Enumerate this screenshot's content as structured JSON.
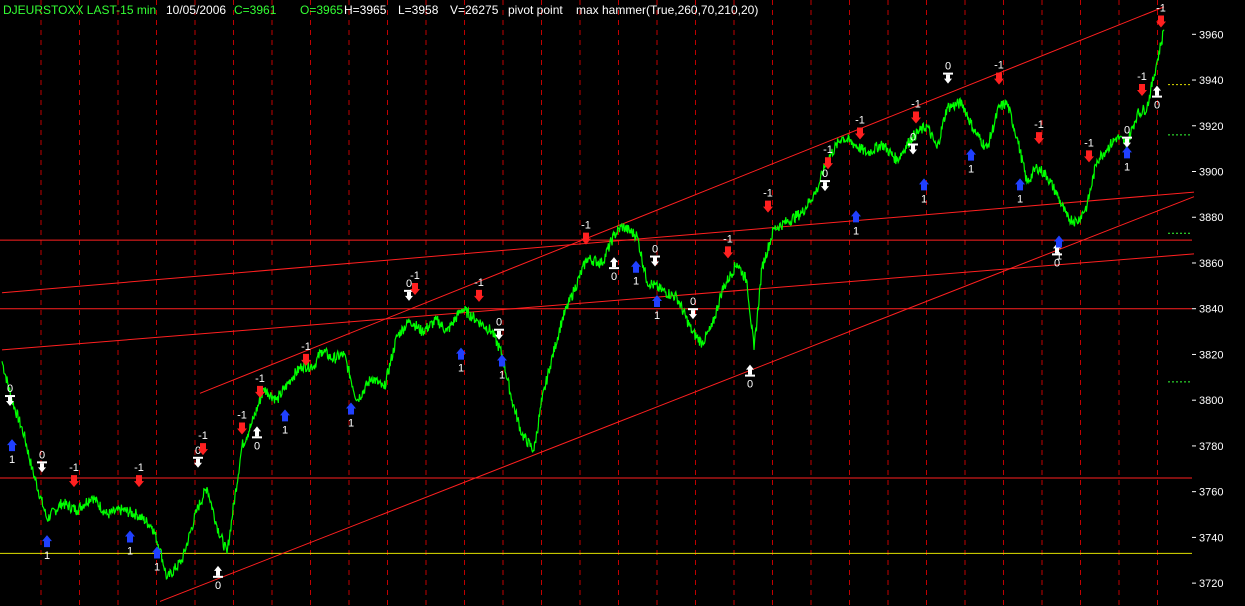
{
  "header": {
    "symbol": "DJEURSTOXX LAST-15 min",
    "date": "10/05/2006",
    "close": "C=3961",
    "open": "O=3965",
    "high": "H=3965",
    "low": "L=3958",
    "volume": "V=26275",
    "indicator1": "pivot point",
    "indicator2": "max hammer(True,260,70,210,20)"
  },
  "colors": {
    "background": "#000000",
    "price": "#00ff00",
    "grid": "#c00000",
    "trendline": "#ff2020",
    "level_yellow": "#e0e000",
    "down_arrow": "#ff2020",
    "up_arrow_blue": "#2040ff",
    "up_arrow_white": "#ffffff",
    "tick_text": "#ffffff"
  },
  "chart_data": {
    "type": "line",
    "title": "",
    "xlabel": "",
    "ylabel": "",
    "ylim": [
      3710,
      3975
    ],
    "y_ticks": [
      3720,
      3740,
      3760,
      3780,
      3800,
      3820,
      3840,
      3860,
      3880,
      3900,
      3920,
      3940,
      3960
    ],
    "grid": "dashed vertical lines only",
    "x_domain": [
      0,
      1165
    ],
    "series": [
      {
        "x": [
          0,
          10,
          22,
          30,
          45,
          60,
          75,
          90,
          105,
          120,
          135,
          150,
          158,
          165,
          180,
          195,
          205,
          215,
          225,
          240,
          250,
          262,
          275,
          290,
          300,
          312,
          320,
          330,
          342,
          355,
          370,
          382,
          395,
          408,
          420,
          435,
          445,
          460,
          475,
          490,
          500,
          510,
          520,
          532,
          540,
          548,
          560,
          572,
          585,
          600,
          612,
          620,
          635,
          645,
          660,
          675,
          690,
          700,
          710,
          720,
          735,
          745,
          752,
          760,
          772,
          785,
          800,
          815,
          825,
          840,
          852,
          865,
          880,
          895,
          910,
          925,
          935,
          945,
          960,
          972,
          985,
          997,
          1005,
          1015,
          1025,
          1035,
          1045,
          1055,
          1065,
          1075,
          1085,
          1095,
          1105,
          1115,
          1125,
          1135,
          1145,
          1155,
          1162
        ],
        "values": [
          3817,
          3800,
          3785,
          3770,
          3748,
          3755,
          3752,
          3758,
          3750,
          3752,
          3750,
          3745,
          3735,
          3722,
          3730,
          3752,
          3762,
          3745,
          3733,
          3780,
          3790,
          3805,
          3800,
          3810,
          3815,
          3815,
          3822,
          3818,
          3820,
          3800,
          3810,
          3805,
          3828,
          3835,
          3830,
          3835,
          3830,
          3840,
          3835,
          3830,
          3820,
          3800,
          3785,
          3778,
          3800,
          3815,
          3835,
          3848,
          3862,
          3860,
          3872,
          3876,
          3872,
          3852,
          3848,
          3845,
          3830,
          3825,
          3832,
          3848,
          3860,
          3852,
          3822,
          3858,
          3875,
          3878,
          3882,
          3892,
          3905,
          3915,
          3912,
          3908,
          3912,
          3905,
          3915,
          3920,
          3910,
          3928,
          3930,
          3918,
          3910,
          3928,
          3930,
          3915,
          3895,
          3902,
          3898,
          3890,
          3880,
          3878,
          3885,
          3905,
          3910,
          3915,
          3912,
          3925,
          3928,
          3948,
          3962
        ]
      }
    ],
    "horizontal_levels": [
      {
        "value": 3870,
        "color": "#ff2020"
      },
      {
        "value": 3840,
        "color": "#ff2020"
      },
      {
        "value": 3766,
        "color": "#ff2020"
      },
      {
        "value": 3733,
        "color": "#e0e000"
      }
    ],
    "trendlines": [
      {
        "x1": 198,
        "y1": 3803,
        "x2": 1162,
        "y2": 3972
      },
      {
        "x1": 0,
        "y1": 3847,
        "x2": 1192,
        "y2": 3891
      },
      {
        "x1": 0,
        "y1": 3822,
        "x2": 1192,
        "y2": 3864
      },
      {
        "x1": 158,
        "y1": 3712,
        "x2": 1192,
        "y2": 3889
      }
    ],
    "right_dashes": [
      {
        "value": 3938,
        "color": "#e0e000"
      },
      {
        "value": 3916,
        "color": "#34ff34"
      },
      {
        "value": 3873,
        "color": "#34ff34"
      },
      {
        "value": 3808,
        "color": "#34ff34"
      }
    ],
    "signals": [
      {
        "x": 8,
        "value": 3797,
        "kind": "white-down",
        "label": "0"
      },
      {
        "x": 10,
        "value": 3783,
        "kind": "blue-up",
        "label": "1"
      },
      {
        "x": 40,
        "value": 3768,
        "kind": "white-down",
        "label": "0"
      },
      {
        "x": 45,
        "value": 3741,
        "kind": "blue-up",
        "label": "1"
      },
      {
        "x": 72,
        "value": 3762,
        "kind": "red-down",
        "label": "-1"
      },
      {
        "x": 128,
        "value": 3743,
        "kind": "blue-up",
        "label": "1"
      },
      {
        "x": 137,
        "value": 3762,
        "kind": "red-down",
        "label": "-1"
      },
      {
        "x": 155,
        "value": 3736,
        "kind": "blue-up",
        "label": "1"
      },
      {
        "x": 196,
        "value": 3770,
        "kind": "white-down",
        "label": "0"
      },
      {
        "x": 201,
        "value": 3776,
        "kind": "red-down",
        "label": "-1"
      },
      {
        "x": 216,
        "value": 3728,
        "kind": "white-up",
        "label": "0"
      },
      {
        "x": 240,
        "value": 3785,
        "kind": "red-down",
        "label": "-1"
      },
      {
        "x": 255,
        "value": 3789,
        "kind": "white-up",
        "label": "0"
      },
      {
        "x": 258,
        "value": 3801,
        "kind": "red-down",
        "label": "-1"
      },
      {
        "x": 283,
        "value": 3796,
        "kind": "blue-up",
        "label": "1"
      },
      {
        "x": 304,
        "value": 3815,
        "kind": "red-down",
        "label": "-1"
      },
      {
        "x": 349,
        "value": 3799,
        "kind": "blue-up",
        "label": "1"
      },
      {
        "x": 407,
        "value": 3843,
        "kind": "white-down",
        "label": "0"
      },
      {
        "x": 413,
        "value": 3846,
        "kind": "red-down",
        "label": "-1"
      },
      {
        "x": 459,
        "value": 3823,
        "kind": "blue-up",
        "label": "1"
      },
      {
        "x": 477,
        "value": 3843,
        "kind": "red-down",
        "label": "-1"
      },
      {
        "x": 497,
        "value": 3826,
        "kind": "white-down",
        "label": "0"
      },
      {
        "x": 500,
        "value": 3820,
        "kind": "blue-up",
        "label": "1"
      },
      {
        "x": 584,
        "value": 3868,
        "kind": "red-down",
        "label": "-1"
      },
      {
        "x": 612,
        "value": 3863,
        "kind": "white-up",
        "label": "0"
      },
      {
        "x": 634,
        "value": 3861,
        "kind": "blue-up",
        "label": "1"
      },
      {
        "x": 653,
        "value": 3858,
        "kind": "white-down",
        "label": "0"
      },
      {
        "x": 655,
        "value": 3846,
        "kind": "blue-up",
        "label": "1"
      },
      {
        "x": 691,
        "value": 3835,
        "kind": "white-down",
        "label": "0"
      },
      {
        "x": 726,
        "value": 3862,
        "kind": "red-down",
        "label": "-1"
      },
      {
        "x": 748,
        "value": 3816,
        "kind": "white-up",
        "label": "0"
      },
      {
        "x": 766,
        "value": 3882,
        "kind": "red-down",
        "label": "-1"
      },
      {
        "x": 823,
        "value": 3891,
        "kind": "white-down",
        "label": "0"
      },
      {
        "x": 826,
        "value": 3901,
        "kind": "red-down",
        "label": "-1"
      },
      {
        "x": 854,
        "value": 3883,
        "kind": "blue-up",
        "label": "1"
      },
      {
        "x": 858,
        "value": 3914,
        "kind": "red-down",
        "label": "-1"
      },
      {
        "x": 911,
        "value": 3907,
        "kind": "white-down",
        "label": "0"
      },
      {
        "x": 914,
        "value": 3921,
        "kind": "red-down",
        "label": "-1"
      },
      {
        "x": 922,
        "value": 3897,
        "kind": "blue-up",
        "label": "1"
      },
      {
        "x": 946,
        "value": 3938,
        "kind": "white-down",
        "label": "0"
      },
      {
        "x": 969,
        "value": 3910,
        "kind": "blue-up",
        "label": "1"
      },
      {
        "x": 997,
        "value": 3938,
        "kind": "red-down",
        "label": "-1"
      },
      {
        "x": 1018,
        "value": 3897,
        "kind": "blue-up",
        "label": "1"
      },
      {
        "x": 1037,
        "value": 3912,
        "kind": "red-down",
        "label": "-1"
      },
      {
        "x": 1055,
        "value": 3869,
        "kind": "white-up",
        "label": "0"
      },
      {
        "x": 1057,
        "value": 3872,
        "kind": "blue-up",
        "label": "1"
      },
      {
        "x": 1087,
        "value": 3904,
        "kind": "red-down",
        "label": "-1"
      },
      {
        "x": 1125,
        "value": 3910,
        "kind": "white-down",
        "label": "0"
      },
      {
        "x": 1125,
        "value": 3911,
        "kind": "blue-up",
        "label": "1"
      },
      {
        "x": 1140,
        "value": 3933,
        "kind": "red-down",
        "label": "-1"
      },
      {
        "x": 1155,
        "value": 3938,
        "kind": "white-up",
        "label": "0"
      },
      {
        "x": 1159,
        "value": 3963,
        "kind": "red-down",
        "label": "-1"
      }
    ]
  }
}
